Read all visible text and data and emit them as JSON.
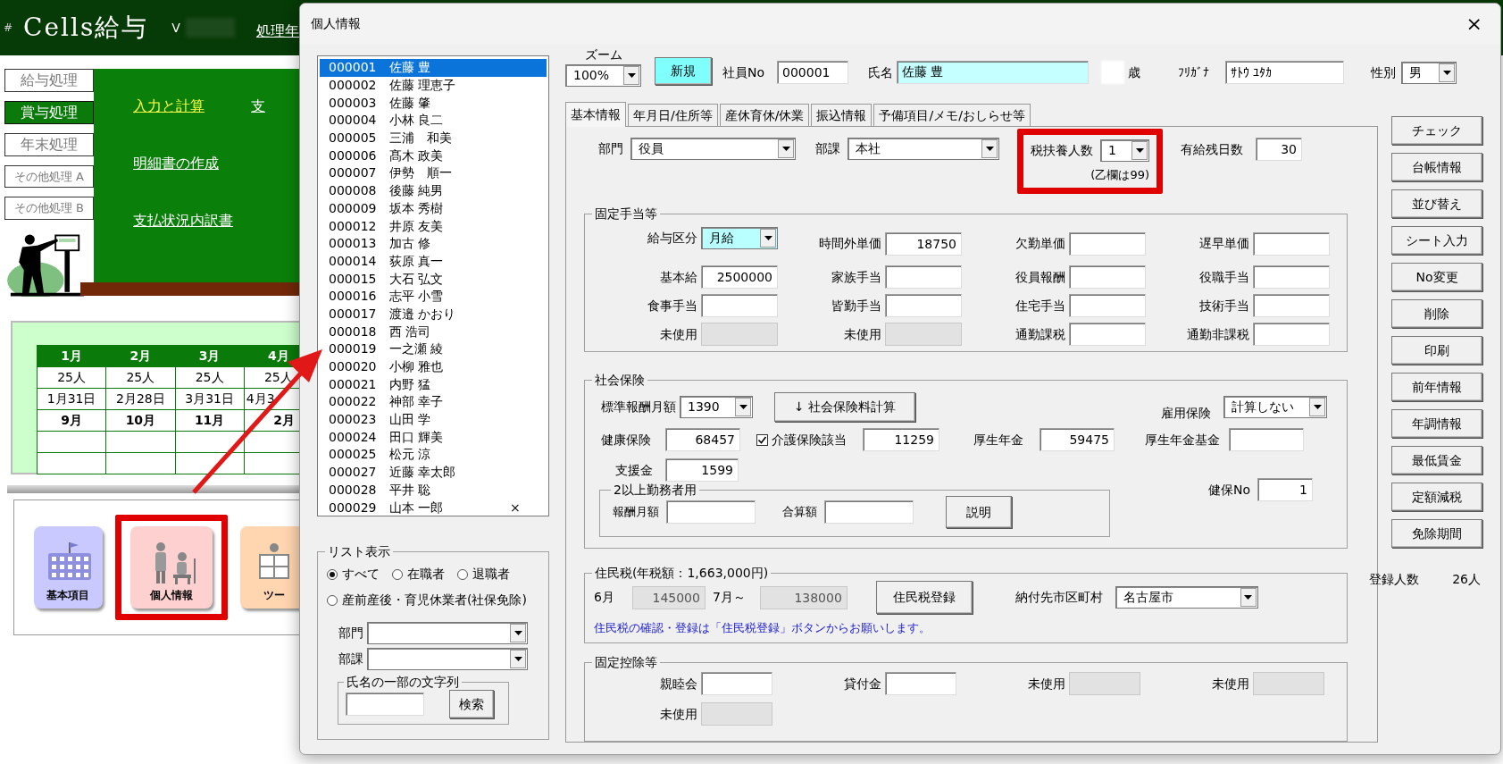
{
  "background_app": {
    "header": {
      "hash": "#",
      "title": "Cells給与",
      "version": "V",
      "year_label": "処理年"
    },
    "menu": [
      {
        "label": "給与処理",
        "selected": false
      },
      {
        "label": "賞与処理",
        "selected": true
      },
      {
        "label": "年末処理",
        "selected": false
      },
      {
        "label": "その他処理 A",
        "selected": false
      },
      {
        "label": "その他処理 B",
        "selected": false
      }
    ],
    "board_rows": [
      [
        {
          "label": "入力と計算",
          "highlighted": true
        },
        {
          "label": "支",
          "highlighted": false
        }
      ],
      [
        {
          "label": "明細書の作成",
          "highlighted": false
        }
      ],
      [
        {
          "label": "支払状況内訳書",
          "highlighted": false
        }
      ]
    ],
    "calendar": {
      "months": [
        "1月",
        "2月",
        "3月",
        "4月"
      ],
      "counts": [
        "25人",
        "25人",
        "25人",
        "25人"
      ],
      "dates": [
        "1月31日",
        "2月28日",
        "3月31日",
        "4月3"
      ],
      "next_months": [
        "9月",
        "10月",
        "11月",
        "2月"
      ]
    },
    "shortcuts": [
      {
        "label": "基本項目",
        "kind": "building",
        "highlighted": false
      },
      {
        "label": "個人情報",
        "kind": "people",
        "highlighted": true
      },
      {
        "label": "ツー",
        "kind": "worker",
        "highlighted": false
      }
    ]
  },
  "dialog": {
    "title": "個人情報",
    "close": "×",
    "employees": [
      {
        "id": "000001",
        "name": "佐藤 豊",
        "selected": true
      },
      {
        "id": "000002",
        "name": "佐藤 理恵子",
        "selected": false
      },
      {
        "id": "000003",
        "name": "佐藤 肇",
        "selected": false
      },
      {
        "id": "000004",
        "name": "小林 良二",
        "selected": false
      },
      {
        "id": "000005",
        "name": "三浦　和美",
        "selected": false
      },
      {
        "id": "000006",
        "name": "髙木 政美",
        "selected": false
      },
      {
        "id": "000007",
        "name": "伊勢　順一",
        "selected": false
      },
      {
        "id": "000008",
        "name": "後藤 純男",
        "selected": false
      },
      {
        "id": "000009",
        "name": "坂本 秀樹",
        "selected": false
      },
      {
        "id": "000012",
        "name": "井原 友美",
        "selected": false
      },
      {
        "id": "000013",
        "name": "加古 修",
        "selected": false
      },
      {
        "id": "000014",
        "name": "荻原 真一",
        "selected": false
      },
      {
        "id": "000015",
        "name": "大石 弘文",
        "selected": false
      },
      {
        "id": "000016",
        "name": "志平 小雪",
        "selected": false
      },
      {
        "id": "000017",
        "name": "渡邉 かおり",
        "selected": false
      },
      {
        "id": "000018",
        "name": "西 浩司",
        "selected": false
      },
      {
        "id": "000019",
        "name": "一之瀬 綾",
        "selected": false
      },
      {
        "id": "000020",
        "name": "小柳 雅也",
        "selected": false
      },
      {
        "id": "000021",
        "name": "内野 猛",
        "selected": false
      },
      {
        "id": "000022",
        "name": "神部 幸子",
        "selected": false
      },
      {
        "id": "000023",
        "name": "山田 学",
        "selected": false
      },
      {
        "id": "000024",
        "name": "田口 輝美",
        "selected": false
      },
      {
        "id": "000025",
        "name": "松元 涼",
        "selected": false
      },
      {
        "id": "000027",
        "name": "近藤 幸太郎",
        "selected": false
      },
      {
        "id": "000028",
        "name": "平井 聡",
        "selected": false
      },
      {
        "id": "000029",
        "name": "山本 一郎",
        "selected": false,
        "mark": "×"
      }
    ],
    "list_filter": {
      "title": "リスト表示",
      "options": [
        {
          "label": "すべて",
          "selected": true
        },
        {
          "label": "在職者",
          "selected": false
        },
        {
          "label": "退職者",
          "selected": false
        },
        {
          "label": "産前産後・育児休業者(社保免除)",
          "selected": false
        }
      ],
      "department_label": "部門",
      "section_label": "部課",
      "search_title": "氏名の一部の文字列",
      "search_button": "検索"
    },
    "header": {
      "zoom_label": "ズーム",
      "zoom": "100%",
      "new_button": "新規",
      "employee_no_label": "社員No",
      "employee_no": "000001",
      "name_label": "氏名",
      "name": "佐藤 豊",
      "age_suffix": "歳",
      "kana_label": "ﾌﾘｶﾞﾅ",
      "kana": "ｻﾄｳ ﾕﾀｶ",
      "gender_label": "性別",
      "gender": "男"
    },
    "tabs": [
      {
        "label": "基本情報",
        "selected": true
      },
      {
        "label": "年月日/住所等",
        "selected": false
      },
      {
        "label": "産休育休/休業",
        "selected": false
      },
      {
        "label": "振込情報",
        "selected": false
      },
      {
        "label": "予備項目/メモ/おしらせ等",
        "selected": false
      }
    ],
    "top_row": [
      {
        "label": "部門",
        "value": "役員",
        "kind": "select",
        "highlighted": false
      },
      {
        "label": "部課",
        "value": "本社",
        "kind": "select",
        "highlighted": false
      },
      {
        "label": "税扶養人数",
        "value": "1",
        "kind": "select",
        "highlighted": true,
        "note": "(乙欄は99)"
      },
      {
        "label": "有給残日数",
        "value": "30",
        "kind": "text",
        "highlighted": false
      }
    ],
    "allowances": {
      "title": "固定手当等",
      "fields": [
        {
          "label": "給与区分",
          "value": "月給",
          "kind": "select",
          "accent": true,
          "disabled": false
        },
        {
          "label": "時間外単価",
          "value": "18750",
          "kind": "text",
          "disabled": false
        },
        {
          "label": "欠勤単価",
          "kind": "text",
          "disabled": false
        },
        {
          "label": "遅早単価",
          "kind": "text",
          "disabled": false
        },
        {
          "label": "基本給",
          "value": "2500000",
          "kind": "text",
          "disabled": false
        },
        {
          "label": "家族手当",
          "kind": "text",
          "disabled": false
        },
        {
          "label": "役員報酬",
          "kind": "text",
          "disabled": false
        },
        {
          "label": "役職手当",
          "kind": "text",
          "disabled": false
        },
        {
          "label": "食事手当",
          "kind": "text",
          "disabled": false
        },
        {
          "label": "皆勤手当",
          "kind": "text",
          "disabled": false
        },
        {
          "label": "住宅手当",
          "kind": "text",
          "disabled": false
        },
        {
          "label": "技術手当",
          "kind": "text",
          "disabled": false
        },
        {
          "label": "未使用",
          "kind": "text",
          "disabled": true
        },
        {
          "label": "未使用",
          "kind": "text",
          "disabled": true
        },
        {
          "label": "通勤課税",
          "kind": "text",
          "disabled": false
        },
        {
          "label": "通勤非課税",
          "kind": "text",
          "disabled": false
        }
      ]
    },
    "social_insurance": {
      "title": "社会保険",
      "standard_monthly": {
        "label": "標準報酬月額",
        "value": "1390"
      },
      "calc_button": "↓ 社会保険料計算",
      "employment": {
        "label": "雇用保険",
        "value": "計算しない"
      },
      "amounts": [
        {
          "label": "健康保険",
          "value": "68457",
          "kind": "text"
        },
        {
          "label": "介護保険該当",
          "value": "11259",
          "kind": "checkbox",
          "checked": true
        },
        {
          "label": "厚生年金",
          "value": "59475",
          "kind": "text"
        },
        {
          "label": "厚生年金基金",
          "kind": "text"
        }
      ],
      "support": {
        "label": "支援金",
        "value": "1599"
      },
      "multi": {
        "title": "2以上勤務者用",
        "fields": [
          {
            "label": "報酬月額"
          },
          {
            "label": "合算額"
          }
        ],
        "button": "説明"
      },
      "kenpo_no": {
        "label": "健保No",
        "value": "1"
      }
    },
    "resident_tax": {
      "title": "住民税(年税額：1,663,000円)",
      "june": {
        "label": "6月",
        "value": "145000",
        "disabled": true
      },
      "july": {
        "label": "7月～",
        "value": "138000",
        "disabled": true
      },
      "button": "住民税登録",
      "municipality": {
        "label": "納付先市区町村",
        "value": "名古屋市"
      },
      "note": "住民税の確認・登録は「住民税登録」ボタンからお願いします。"
    },
    "fixed_deductions": {
      "title": "固定控除等",
      "fields": [
        {
          "label": "親睦会",
          "disabled": false
        },
        {
          "label": "貸付金",
          "disabled": false
        },
        {
          "label": "未使用",
          "disabled": true
        },
        {
          "label": "未使用",
          "disabled": true
        },
        {
          "label": "未使用",
          "disabled": true
        }
      ]
    },
    "side_buttons": [
      "チェック",
      "台帳情報",
      "並び替え",
      "シート入力",
      "No変更",
      "削除",
      "印刷",
      "前年情報",
      "年調情報",
      "最低賃金",
      "定額減税",
      "免除期間"
    ],
    "registered": {
      "label": "登録人数",
      "value": "26人"
    }
  }
}
